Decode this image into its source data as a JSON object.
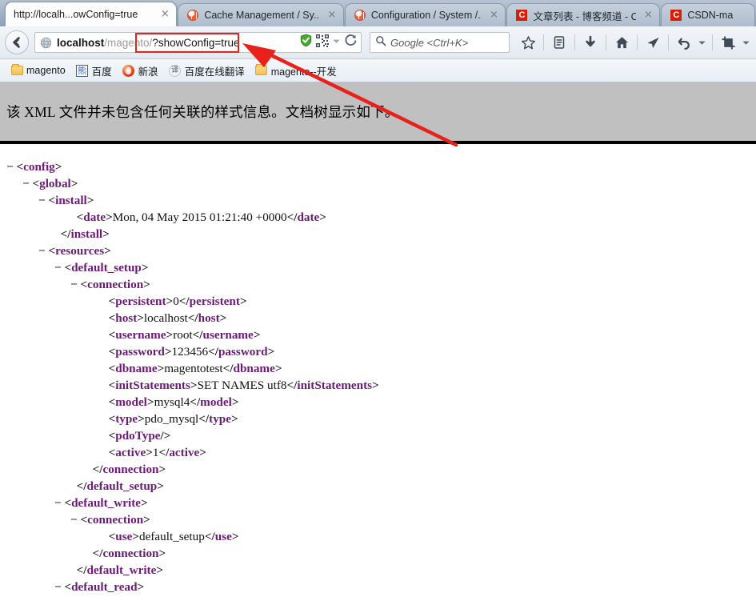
{
  "browser": {
    "tabs": [
      {
        "title": "http://localh...owConfig=true",
        "favicon": "none",
        "active": true,
        "close_label": "×"
      },
      {
        "title": "Cache Management / Sy...",
        "favicon": "magento-icon",
        "active": false,
        "close_label": "×"
      },
      {
        "title": "Configuration / System /...",
        "favicon": "magento-icon",
        "active": false,
        "close_label": "×"
      },
      {
        "title": "文章列表 - 博客频道 - CS...",
        "favicon": "csdn-icon",
        "active": false,
        "close_label": "×"
      },
      {
        "title": "CSDN-ma",
        "favicon": "csdn-icon",
        "active": false,
        "close_label": ""
      }
    ],
    "navigation": {
      "back_button": "back-arrow-icon",
      "url": {
        "host": "localhost",
        "path": "/magento/",
        "query": "?showConfig=true",
        "full": "localhost/magento/?showConfig=true"
      },
      "url_icons": [
        "shield-check-icon",
        "qr-code-icon",
        "chevron-down-icon",
        "reload-icon"
      ]
    },
    "search": {
      "placeholder": "Google <Ctrl+K>",
      "icon": "search-icon"
    },
    "toolbar_icons": [
      "star-icon",
      "reader-list-icon",
      "download-icon",
      "home-icon",
      "paper-plane-icon",
      "undo-icon",
      "chevron-down-icon",
      "crop-capture-icon",
      "chevron-down-icon"
    ],
    "bookmarks": [
      {
        "label": "magento",
        "icon": "folder-icon"
      },
      {
        "label": "百度",
        "icon": "baidu-icon",
        "glyph": "熊"
      },
      {
        "label": "新浪",
        "icon": "sina-icon"
      },
      {
        "label": "百度在线翻译",
        "icon": "fanyi-icon",
        "glyph": "译"
      },
      {
        "label": "magento--开发",
        "icon": "folder-icon"
      }
    ]
  },
  "page": {
    "notice": "该 XML 文件并未包含任何关联的样式信息。文档树显示如下。",
    "xml_lines": [
      {
        "indent": 0,
        "toggle": "−",
        "parts": [
          {
            "t": "br",
            "s": "<"
          },
          {
            "t": "tw",
            "s": "config"
          },
          {
            "t": "br",
            "s": ">"
          }
        ]
      },
      {
        "indent": 1,
        "toggle": "−",
        "parts": [
          {
            "t": "br",
            "s": "<"
          },
          {
            "t": "tw",
            "s": "global"
          },
          {
            "t": "br",
            "s": ">"
          }
        ]
      },
      {
        "indent": 2,
        "toggle": "−",
        "parts": [
          {
            "t": "br",
            "s": "<"
          },
          {
            "t": "tw",
            "s": "install"
          },
          {
            "t": "br",
            "s": ">"
          }
        ]
      },
      {
        "indent": 4,
        "toggle": "",
        "parts": [
          {
            "t": "br",
            "s": "<"
          },
          {
            "t": "tw",
            "s": "date"
          },
          {
            "t": "br",
            "s": ">"
          },
          {
            "t": "tv",
            "s": "Mon, 04 May 2015 01:21:40 +0000"
          },
          {
            "t": "br",
            "s": "</"
          },
          {
            "t": "tw",
            "s": "date"
          },
          {
            "t": "br",
            "s": ">"
          }
        ]
      },
      {
        "indent": 3,
        "toggle": "",
        "parts": [
          {
            "t": "br",
            "s": "</"
          },
          {
            "t": "tw",
            "s": "install"
          },
          {
            "t": "br",
            "s": ">"
          }
        ]
      },
      {
        "indent": 2,
        "toggle": "−",
        "parts": [
          {
            "t": "br",
            "s": "<"
          },
          {
            "t": "tw",
            "s": "resources"
          },
          {
            "t": "br",
            "s": ">"
          }
        ]
      },
      {
        "indent": 3,
        "toggle": "−",
        "parts": [
          {
            "t": "br",
            "s": "<"
          },
          {
            "t": "tw",
            "s": "default_setup"
          },
          {
            "t": "br",
            "s": ">"
          }
        ]
      },
      {
        "indent": 4,
        "toggle": "−",
        "parts": [
          {
            "t": "br",
            "s": "<"
          },
          {
            "t": "tw",
            "s": "connection"
          },
          {
            "t": "br",
            "s": ">"
          }
        ]
      },
      {
        "indent": 6,
        "toggle": "",
        "parts": [
          {
            "t": "br",
            "s": "<"
          },
          {
            "t": "tw",
            "s": "persistent"
          },
          {
            "t": "br",
            "s": ">"
          },
          {
            "t": "tv",
            "s": "0"
          },
          {
            "t": "br",
            "s": "</"
          },
          {
            "t": "tw",
            "s": "persistent"
          },
          {
            "t": "br",
            "s": ">"
          }
        ]
      },
      {
        "indent": 6,
        "toggle": "",
        "parts": [
          {
            "t": "br",
            "s": "<"
          },
          {
            "t": "tw",
            "s": "host"
          },
          {
            "t": "br",
            "s": ">"
          },
          {
            "t": "tv",
            "s": "localhost"
          },
          {
            "t": "br",
            "s": "</"
          },
          {
            "t": "tw",
            "s": "host"
          },
          {
            "t": "br",
            "s": ">"
          }
        ]
      },
      {
        "indent": 6,
        "toggle": "",
        "parts": [
          {
            "t": "br",
            "s": "<"
          },
          {
            "t": "tw",
            "s": "username"
          },
          {
            "t": "br",
            "s": ">"
          },
          {
            "t": "tv",
            "s": "root"
          },
          {
            "t": "br",
            "s": "</"
          },
          {
            "t": "tw",
            "s": "username"
          },
          {
            "t": "br",
            "s": ">"
          }
        ]
      },
      {
        "indent": 6,
        "toggle": "",
        "parts": [
          {
            "t": "br",
            "s": "<"
          },
          {
            "t": "tw",
            "s": "password"
          },
          {
            "t": "br",
            "s": ">"
          },
          {
            "t": "tv",
            "s": "123456"
          },
          {
            "t": "br",
            "s": "</"
          },
          {
            "t": "tw",
            "s": "password"
          },
          {
            "t": "br",
            "s": ">"
          }
        ]
      },
      {
        "indent": 6,
        "toggle": "",
        "parts": [
          {
            "t": "br",
            "s": "<"
          },
          {
            "t": "tw",
            "s": "dbname"
          },
          {
            "t": "br",
            "s": ">"
          },
          {
            "t": "tv",
            "s": "magentotest"
          },
          {
            "t": "br",
            "s": "</"
          },
          {
            "t": "tw",
            "s": "dbname"
          },
          {
            "t": "br",
            "s": ">"
          }
        ]
      },
      {
        "indent": 6,
        "toggle": "",
        "parts": [
          {
            "t": "br",
            "s": "<"
          },
          {
            "t": "tw",
            "s": "initStatements"
          },
          {
            "t": "br",
            "s": ">"
          },
          {
            "t": "tv",
            "s": "SET NAMES utf8"
          },
          {
            "t": "br",
            "s": "</"
          },
          {
            "t": "tw",
            "s": "initStatements"
          },
          {
            "t": "br",
            "s": ">"
          }
        ]
      },
      {
        "indent": 6,
        "toggle": "",
        "parts": [
          {
            "t": "br",
            "s": "<"
          },
          {
            "t": "tw",
            "s": "model"
          },
          {
            "t": "br",
            "s": ">"
          },
          {
            "t": "tv",
            "s": "mysql4"
          },
          {
            "t": "br",
            "s": "</"
          },
          {
            "t": "tw",
            "s": "model"
          },
          {
            "t": "br",
            "s": ">"
          }
        ]
      },
      {
        "indent": 6,
        "toggle": "",
        "parts": [
          {
            "t": "br",
            "s": "<"
          },
          {
            "t": "tw",
            "s": "type"
          },
          {
            "t": "br",
            "s": ">"
          },
          {
            "t": "tv",
            "s": "pdo_mysql"
          },
          {
            "t": "br",
            "s": "</"
          },
          {
            "t": "tw",
            "s": "type"
          },
          {
            "t": "br",
            "s": ">"
          }
        ]
      },
      {
        "indent": 6,
        "toggle": "",
        "parts": [
          {
            "t": "br",
            "s": "<"
          },
          {
            "t": "tw",
            "s": "pdoType"
          },
          {
            "t": "br",
            "s": "/>"
          }
        ]
      },
      {
        "indent": 6,
        "toggle": "",
        "parts": [
          {
            "t": "br",
            "s": "<"
          },
          {
            "t": "tw",
            "s": "active"
          },
          {
            "t": "br",
            "s": ">"
          },
          {
            "t": "tv",
            "s": "1"
          },
          {
            "t": "br",
            "s": "</"
          },
          {
            "t": "tw",
            "s": "active"
          },
          {
            "t": "br",
            "s": ">"
          }
        ]
      },
      {
        "indent": 5,
        "toggle": "",
        "parts": [
          {
            "t": "br",
            "s": "</"
          },
          {
            "t": "tw",
            "s": "connection"
          },
          {
            "t": "br",
            "s": ">"
          }
        ]
      },
      {
        "indent": 4,
        "toggle": "",
        "parts": [
          {
            "t": "br",
            "s": "</"
          },
          {
            "t": "tw",
            "s": "default_setup"
          },
          {
            "t": "br",
            "s": ">"
          }
        ]
      },
      {
        "indent": 3,
        "toggle": "−",
        "parts": [
          {
            "t": "br",
            "s": "<"
          },
          {
            "t": "tw",
            "s": "default_write"
          },
          {
            "t": "br",
            "s": ">"
          }
        ]
      },
      {
        "indent": 4,
        "toggle": "−",
        "parts": [
          {
            "t": "br",
            "s": "<"
          },
          {
            "t": "tw",
            "s": "connection"
          },
          {
            "t": "br",
            "s": ">"
          }
        ]
      },
      {
        "indent": 6,
        "toggle": "",
        "parts": [
          {
            "t": "br",
            "s": "<"
          },
          {
            "t": "tw",
            "s": "use"
          },
          {
            "t": "br",
            "s": ">"
          },
          {
            "t": "tv",
            "s": "default_setup"
          },
          {
            "t": "br",
            "s": "</"
          },
          {
            "t": "tw",
            "s": "use"
          },
          {
            "t": "br",
            "s": ">"
          }
        ]
      },
      {
        "indent": 5,
        "toggle": "",
        "parts": [
          {
            "t": "br",
            "s": "</"
          },
          {
            "t": "tw",
            "s": "connection"
          },
          {
            "t": "br",
            "s": ">"
          }
        ]
      },
      {
        "indent": 4,
        "toggle": "",
        "parts": [
          {
            "t": "br",
            "s": "</"
          },
          {
            "t": "tw",
            "s": "default_write"
          },
          {
            "t": "br",
            "s": ">"
          }
        ]
      },
      {
        "indent": 3,
        "toggle": "−",
        "parts": [
          {
            "t": "br",
            "s": "<"
          },
          {
            "t": "tw",
            "s": "default_read"
          },
          {
            "t": "br",
            "s": ">"
          }
        ]
      }
    ]
  },
  "annotations": {
    "highlight_box_color": "#e8211b",
    "arrow_color": "#e8211b",
    "arrow_target": "url-query-highlight"
  }
}
